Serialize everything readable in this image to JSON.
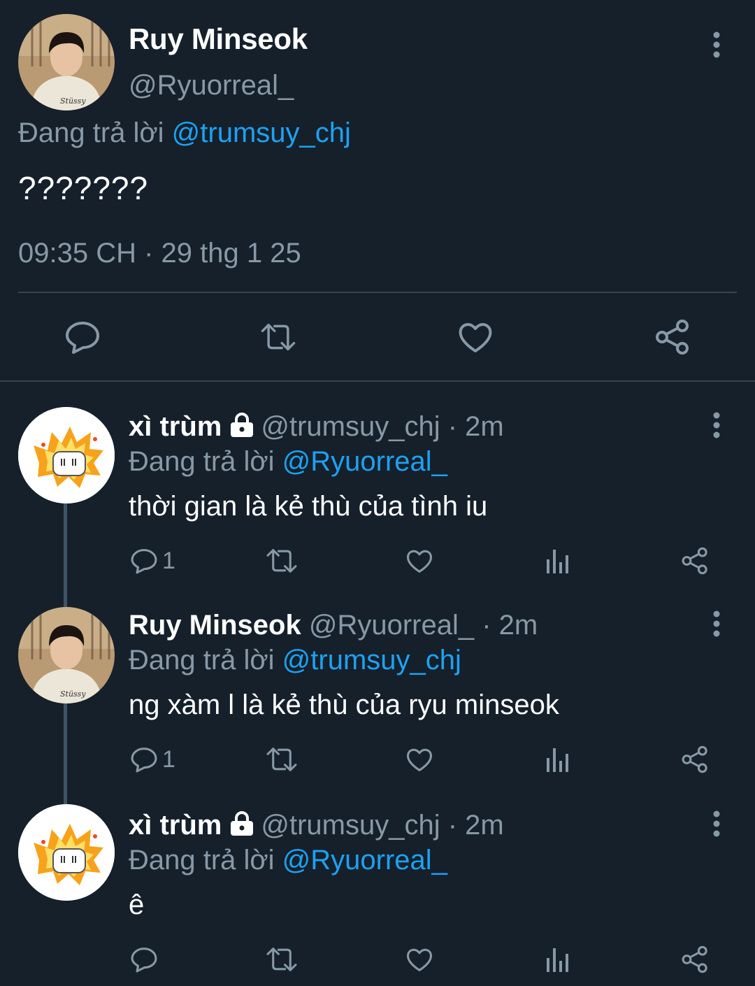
{
  "main_tweet": {
    "name": "Ruy Minseok",
    "handle": "@Ryuorreal_",
    "replying_prefix": "Đang trả lời",
    "replying_to": "@trumsuy_chj",
    "text": "???????",
    "time": "09:35 CH",
    "separator": " · ",
    "date": "29 thg 1 25",
    "actions": [
      "reply-icon",
      "retweet-icon",
      "like-icon",
      "share-icon"
    ]
  },
  "replies": [
    {
      "name": "xì trùm",
      "protected": true,
      "handle": "@trumsuy_chj",
      "separator": " · ",
      "time": "2m",
      "replying_prefix": "Đang trả lời",
      "replying_to": "@Ryuorreal_",
      "text": "thời gian là kẻ thù của tình iu",
      "reply_count": "1"
    },
    {
      "name": "Ruy Minseok",
      "protected": false,
      "handle": "@Ryuorreal_",
      "separator": " · ",
      "time": "2m",
      "replying_prefix": "Đang trả lời",
      "replying_to": "@trumsuy_chj",
      "text": "ng xàm l là kẻ thù của ryu minseok",
      "reply_count": "1"
    },
    {
      "name": "xì trùm",
      "protected": true,
      "handle": "@trumsuy_chj",
      "separator": " · ",
      "time": "2m",
      "replying_prefix": "Đang trả lời",
      "replying_to": "@Ryuorreal_",
      "text": "ê",
      "reply_count": ""
    }
  ],
  "colors": {
    "background": "#15202b",
    "secondary_text": "#8899a6",
    "accent": "#1da1f2",
    "divider": "#38444d"
  }
}
